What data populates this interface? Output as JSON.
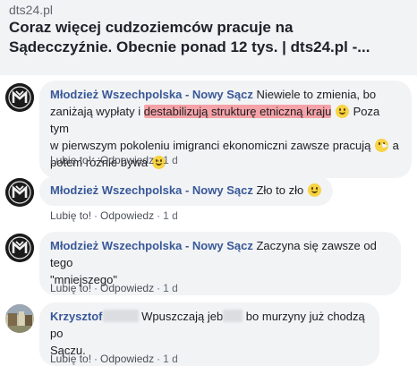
{
  "link_preview": {
    "domain": "dts24.pl",
    "title_line1": "Coraz więcej cudzoziemców pracuje na",
    "title_line2": "Sądecczyźnie. Obecnie ponad 12 tys. | dts24.pl -..."
  },
  "comments": [
    {
      "author": "Młodzież Wszechpolska - Nowy Sącz",
      "text_1": " Niewiele to zmienia, bo",
      "text_2": "zaniżają wypłaty i ",
      "highlight": "destabilizują strukturę etniczną kraju",
      "text_3": " Poza tym",
      "text_4": "w pierwszym pokoleniu imigranci ekonomiczni zawsze pracują ",
      "text_5": " a",
      "text_6": "potem różnie bywa ",
      "like": "Lubię to!",
      "reply": "Odpowiedz",
      "time": "1 d"
    },
    {
      "author": "Młodzież Wszechpolska - Nowy Sącz",
      "text_1": " Zło to zło ",
      "like": "Lubię to!",
      "reply": "Odpowiedz",
      "time": "1 d"
    },
    {
      "author": "Młodzież Wszechpolska - Nowy Sącz",
      "text_1": " Zaczyna się zawsze od tego",
      "text_2": "\"mniejszego\"",
      "like": "Lubię to!",
      "reply": "Odpowiedz",
      "time": "1 d"
    },
    {
      "author": "Krzysztof",
      "text_1": "Wpuszczają jeb",
      "text_2": " bo murzyny już chodzą po",
      "text_3": "Sączu.",
      "like": "Lubię to!",
      "reply": "Odpowiedz",
      "time": "1 d"
    }
  ],
  "separator": "·",
  "icons": {
    "org_avatar": "org-logo-icon",
    "user_avatar": "user-photo-icon",
    "emoji": "smile-emoji-icon",
    "emoji_pac": "pacman-emoji-icon"
  }
}
